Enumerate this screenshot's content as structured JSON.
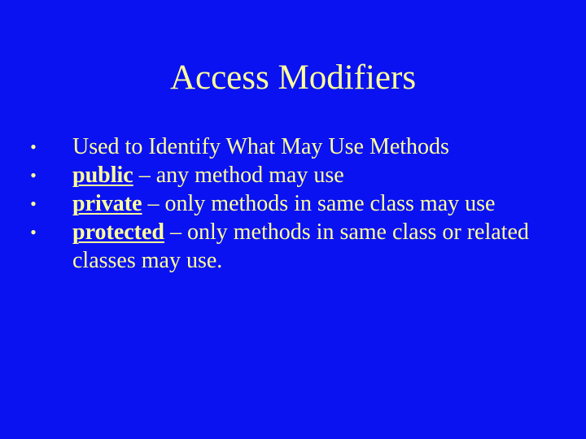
{
  "slide": {
    "title": "Access Modifiers",
    "colors": {
      "background": "#0a12f2",
      "text": "#ffff99"
    },
    "bullets": [
      {
        "keyword": "",
        "text": "Used to Identify What May Use Methods"
      },
      {
        "keyword": "public",
        "text": " – any method may use"
      },
      {
        "keyword": "private",
        "text": " – only methods in same class may use"
      },
      {
        "keyword": "protected",
        "text": " – only methods in same class or related classes may use."
      }
    ],
    "bullet_glyph": "•"
  }
}
